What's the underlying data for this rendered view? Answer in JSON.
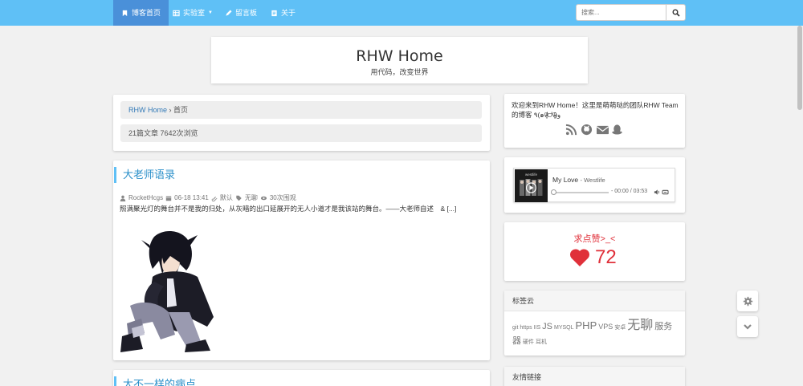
{
  "nav": {
    "items": [
      {
        "label": "博客首页",
        "icon": "bookmark-icon"
      },
      {
        "label": "实验室",
        "icon": "table-icon"
      },
      {
        "label": "留言板",
        "icon": "pencil-icon"
      },
      {
        "label": "关于",
        "icon": "document-icon"
      }
    ],
    "search_placeholder": "搜索...",
    "accent": "#5fc0f6",
    "active": "#4a90d9"
  },
  "header": {
    "title": "RHW Home",
    "subtitle": "用代码，改变世界"
  },
  "breadcrumb": {
    "home": "RHW Home",
    "sep": "›",
    "current": "首页",
    "stats": "21篇文章 7642次浏览"
  },
  "post": {
    "title": "大老师语录",
    "author": "RocketHcgs",
    "date": "06-18 13:41",
    "category": "默认",
    "tag": "无聊",
    "views": "30次围观",
    "excerpt": "照满聚光灯的舞台并不是我的归处，从灰暗的出口延展开的无人小道才是我该站的舞台。——大老师自述　& [...]"
  },
  "post2": {
    "title": "大不一样的病点"
  },
  "sidebar": {
    "welcome": "欢迎来到RHW Home！这里是萌萌哒的团队RHW Team的博客 ٩(๑ᵒ̴̶̷͈᷄ᗨᵒ̴̶̷͈᷅)و",
    "socials": [
      "rss-icon",
      "github-icon",
      "mail-icon",
      "qq-icon"
    ],
    "music": {
      "song": "My Love",
      "artist": "Westlife",
      "time": "- 00:00 / 03:53"
    },
    "like": {
      "title": "求点赞>_<",
      "count": "72"
    },
    "tags_title": "标签云",
    "tags": [
      {
        "t": "git",
        "s": 7
      },
      {
        "t": "https",
        "s": 7
      },
      {
        "t": "IIS",
        "s": 7
      },
      {
        "t": "JS",
        "s": 11
      },
      {
        "t": "MYSQL",
        "s": 7
      },
      {
        "t": "PHP",
        "s": 13
      },
      {
        "t": "VPS",
        "s": 9
      },
      {
        "t": "安卓",
        "s": 7
      },
      {
        "t": "无聊",
        "s": 16
      },
      {
        "t": "服务器",
        "s": 11
      },
      {
        "t": "硬件",
        "s": 7
      },
      {
        "t": "耳机",
        "s": 7
      }
    ],
    "friends_title": "友情链接"
  }
}
